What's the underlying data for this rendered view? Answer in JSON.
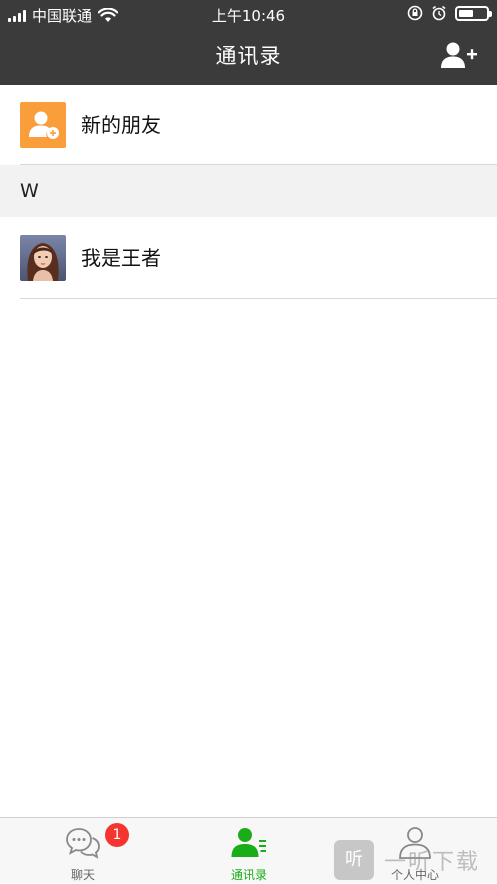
{
  "status_bar": {
    "carrier": "中国联通",
    "time": "上午10:46",
    "battery_level": 0.55
  },
  "nav": {
    "title": "通讯录",
    "add_friend_icon": "add-contact-icon"
  },
  "contacts": {
    "new_friends_label": "新的朋友",
    "sections": [
      {
        "letter": "W",
        "items": [
          {
            "name": "我是王者"
          }
        ]
      }
    ]
  },
  "tabbar": {
    "tabs": [
      {
        "label": "聊天",
        "icon": "chat-icon",
        "badge": "1"
      },
      {
        "label": "通讯录",
        "icon": "contacts-icon",
        "active": true
      },
      {
        "label": "个人中心",
        "icon": "profile-icon"
      }
    ]
  },
  "watermark": {
    "box": "听",
    "text": "一听下载"
  },
  "colors": {
    "header_bg": "#3b3b3b",
    "accent": "#1aad19",
    "new_friend_icon_bg": "#fa9d3b",
    "badge": "#f43530"
  }
}
